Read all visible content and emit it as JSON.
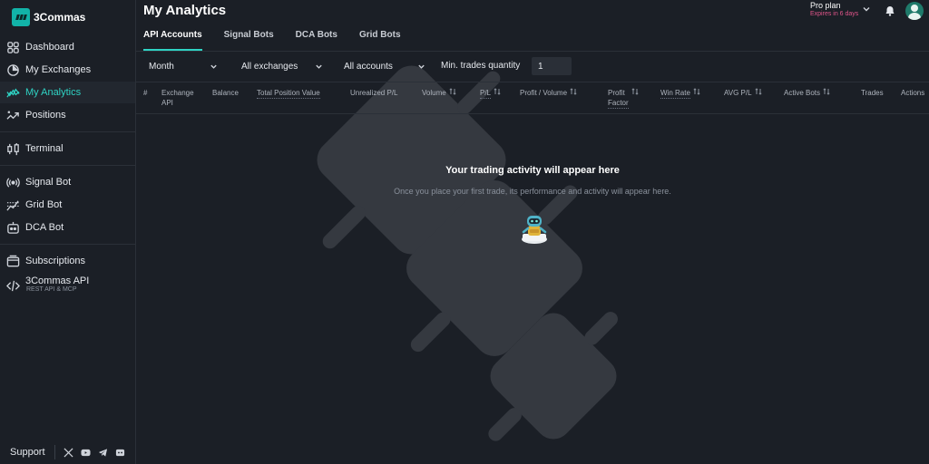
{
  "app": {
    "brand": "3Commas"
  },
  "sidebar": {
    "items": [
      {
        "id": "dashboard",
        "label": "Dashboard",
        "icon": "grid-icon"
      },
      {
        "id": "exchanges",
        "label": "My Exchanges",
        "icon": "pie-chart-icon"
      },
      {
        "id": "analytics",
        "label": "My Analytics",
        "icon": "analytics-icon",
        "active": true
      },
      {
        "id": "positions",
        "label": "Positions",
        "icon": "positions-icon"
      },
      {
        "id": "terminal",
        "label": "Terminal",
        "icon": "candles-icon"
      },
      {
        "id": "signal",
        "label": "Signal Bot",
        "icon": "signal-icon"
      },
      {
        "id": "grid",
        "label": "Grid Bot",
        "icon": "grid-bot-icon"
      },
      {
        "id": "dca",
        "label": "DCA Bot",
        "icon": "robot-icon"
      },
      {
        "id": "subscriptions",
        "label": "Subscriptions",
        "icon": "wallet-icon"
      },
      {
        "id": "api",
        "label": "3Commas API",
        "icon": "code-icon",
        "sub": "REST API & MCP"
      }
    ],
    "support_label": "Support",
    "social": [
      "x-icon",
      "youtube-icon",
      "telegram-icon",
      "discord-icon"
    ]
  },
  "header": {
    "title": "My Analytics",
    "plan_name": "Pro plan",
    "plan_expiry": "Expires in 6 days"
  },
  "tabs": [
    {
      "label": "API Accounts",
      "active": true
    },
    {
      "label": "Signal Bots"
    },
    {
      "label": "DCA Bots"
    },
    {
      "label": "Grid Bots"
    }
  ],
  "filters": {
    "period": "Month",
    "exchanges": "All exchanges",
    "accounts": "All accounts",
    "min_trades_label": "Min. trades quantity",
    "min_trades_value": "1"
  },
  "table": {
    "columns": [
      {
        "label": "#"
      },
      {
        "label": "Exchange\nAPI"
      },
      {
        "label": "Balance"
      },
      {
        "label": "Total Position Value",
        "dotted": true
      },
      {
        "label": "Unrealized P/L"
      },
      {
        "label": "Volume",
        "sortable": true
      },
      {
        "label": "P/L",
        "sortable": true,
        "dotted": true
      },
      {
        "label": "Profit / Volume",
        "sortable": true
      },
      {
        "label": "Profit\nFactor",
        "sortable": true,
        "dotted": true
      },
      {
        "label": "Win Rate",
        "sortable": true,
        "dotted": true
      },
      {
        "label": "AVG P/L",
        "sortable": true
      },
      {
        "label": "Active Bots",
        "sortable": true
      },
      {
        "label": "Trades"
      },
      {
        "label": "Actions"
      }
    ]
  },
  "empty_state": {
    "title": "Your trading activity will appear here",
    "subtitle": "Once you place your first trade, its performance and activity will appear here."
  },
  "colors": {
    "accent": "#2fd3c4",
    "brand": "#12b3a8",
    "background": "#1b1f26",
    "expiry": "#e0558a"
  }
}
